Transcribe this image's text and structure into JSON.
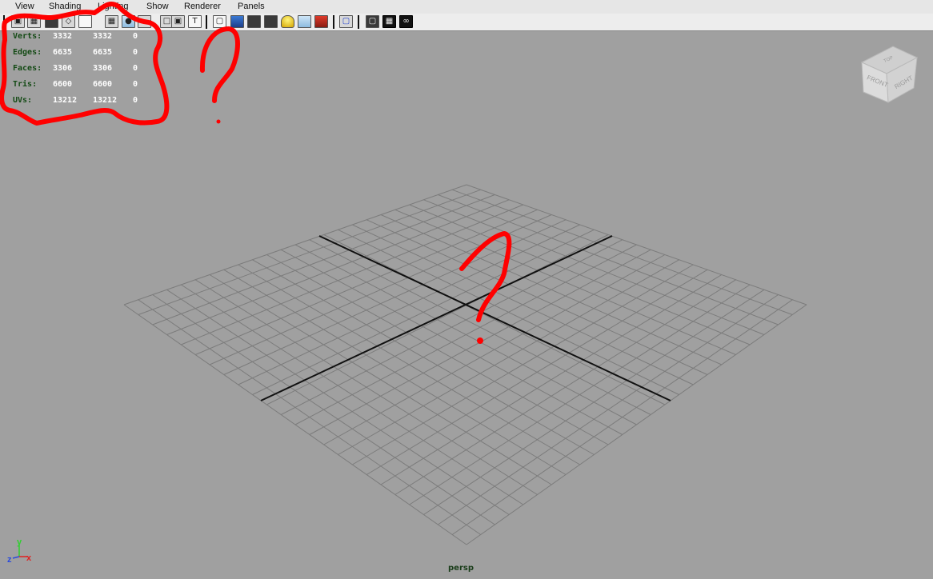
{
  "menu": {
    "items": [
      "View",
      "Shading",
      "Lighting",
      "Show",
      "Renderer",
      "Panels"
    ]
  },
  "toolbar": {
    "icons": [
      "camera-select-icon",
      "camera-attributes-icon",
      "bookmark-icon",
      "image-plane-icon",
      "two-d-pan-icon",
      "grid-toggle-icon",
      "film-gate-icon",
      "resolution-gate-icon",
      "safe-action-icon",
      "safe-title-icon",
      "wireframe-icon",
      "smooth-shade-icon",
      "smooth-shade-all-icon",
      "flat-shade-icon",
      "use-lights-icon",
      "xray-icon",
      "textured-icon",
      "isolate-select-icon",
      "wireframe-on-shaded-icon",
      "shadows-icon",
      "high-quality-icon"
    ]
  },
  "hud": {
    "rows": [
      {
        "label": "Verts:",
        "v1": "3332",
        "v2": "3332",
        "v3": "0"
      },
      {
        "label": "Edges:",
        "v1": "6635",
        "v2": "6635",
        "v3": "0"
      },
      {
        "label": "Faces:",
        "v1": "3306",
        "v2": "3306",
        "v3": "0"
      },
      {
        "label": "Tris:",
        "v1": "6600",
        "v2": "6600",
        "v3": "0"
      },
      {
        "label": "UVs:",
        "v1": "13212",
        "v2": "13212",
        "v3": "0"
      }
    ],
    "label_color": "#134a14",
    "value_color": "#ffffff"
  },
  "viewcube": {
    "front_label": "FRONT",
    "right_label": "RIGHT",
    "top_label": "TOP"
  },
  "axis_indicator": {
    "x": "x",
    "y": "y",
    "z": "z",
    "x_color": "#e02020",
    "y_color": "#2ed02e",
    "z_color": "#2b4bdc"
  },
  "camera": {
    "name": "persp"
  },
  "annotations": {
    "color": "#ff0000",
    "marks": [
      "circle-around-stats",
      "question-mark",
      "question-mark"
    ]
  },
  "colors": {
    "viewport_bg": "#a0a0a0",
    "grid_line": "#7c7c7c",
    "grid_axis": "#111111"
  }
}
